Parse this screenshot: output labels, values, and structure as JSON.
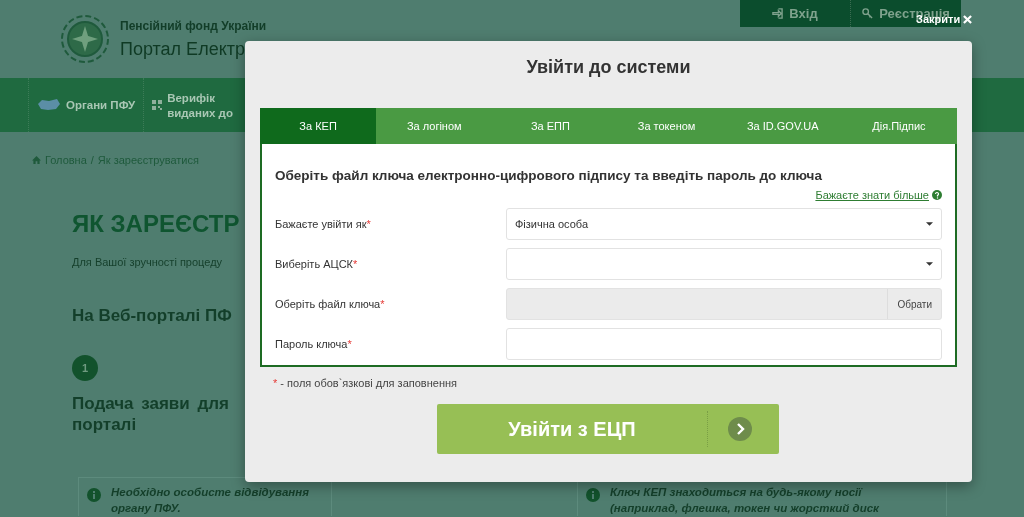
{
  "header": {
    "org": "Пенсійний фонд України",
    "portal_title": "Портал Електр",
    "account_links": [
      {
        "kind": "login",
        "label": "Вхід"
      },
      {
        "kind": "register",
        "label": "Реєстрація"
      }
    ]
  },
  "nav": {
    "items": [
      {
        "kind": "map",
        "lines": [
          "Органи ПФУ"
        ]
      },
      {
        "kind": "qr",
        "lines": [
          "Верифік",
          "виданих до"
        ]
      }
    ]
  },
  "breadcrumb": {
    "home": "Головна",
    "separator": "/",
    "current": "Як зареєструватися"
  },
  "page": {
    "title": "ЯК ЗАРЕЄСТР",
    "intro": "Для Вашої зручності процеду",
    "section_title": "На Веб-порталі ПФ",
    "step_number": "1",
    "step_title": [
      "Подача заяви для",
      "порталі"
    ],
    "notes": [
      {
        "lines": [
          "Необхідно особисте відвідування",
          "органу ПФУ."
        ]
      },
      {
        "lines": [
          "Ключ КЕП знаходиться на будь-якому носії",
          "(наприклад, флешка, токен чи жорсткий диск"
        ]
      }
    ]
  },
  "modal": {
    "close_label": "Закрити",
    "title": "Увійти до системи",
    "tabs": [
      {
        "label": "За КЕП",
        "selected": true
      },
      {
        "label": "За логіном",
        "selected": false
      },
      {
        "label": "За ЕПП",
        "selected": false
      },
      {
        "label": "За токеном",
        "selected": false
      },
      {
        "label": "За ID.GOV.UA",
        "selected": false
      },
      {
        "label": "Дія.Підпис",
        "selected": false
      }
    ],
    "instruction": "Оберіть файл ключа електронно-цифрового підпису та введіть пароль до ключа",
    "help_link": "Бажаєте знати більше",
    "required_mark": "*",
    "fields": [
      {
        "kind": "select",
        "label": "Бажаєте увійти як",
        "required": true,
        "value": "Фізична особа"
      },
      {
        "kind": "select",
        "label": "Виберіть АЦСК",
        "required": true
      },
      {
        "kind": "file",
        "label": "Оберіть файл ключа",
        "required": true,
        "button": "Обрати"
      },
      {
        "kind": "password",
        "label": "Пароль ключа",
        "required": true
      }
    ],
    "required_note": "- поля обов`язкові для заповнення",
    "submit": "Увійти з ЕЦП"
  }
}
